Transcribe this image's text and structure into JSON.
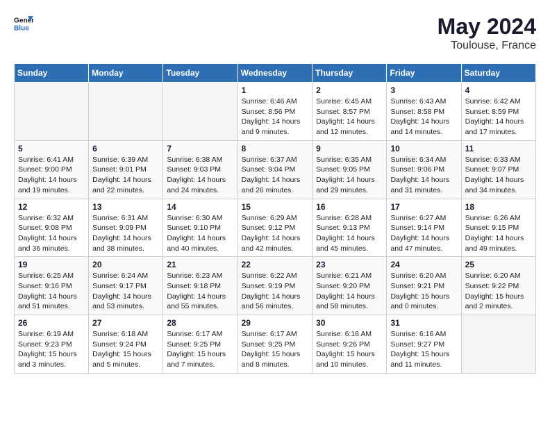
{
  "header": {
    "logo_line1": "General",
    "logo_line2": "Blue",
    "month_year": "May 2024",
    "location": "Toulouse, France"
  },
  "columns": [
    "Sunday",
    "Monday",
    "Tuesday",
    "Wednesday",
    "Thursday",
    "Friday",
    "Saturday"
  ],
  "weeks": [
    [
      {
        "day": "",
        "empty": true
      },
      {
        "day": "",
        "empty": true
      },
      {
        "day": "",
        "empty": true
      },
      {
        "day": "1",
        "sunrise": "6:46 AM",
        "sunset": "8:56 PM",
        "daylight": "14 hours and 9 minutes."
      },
      {
        "day": "2",
        "sunrise": "6:45 AM",
        "sunset": "8:57 PM",
        "daylight": "14 hours and 12 minutes."
      },
      {
        "day": "3",
        "sunrise": "6:43 AM",
        "sunset": "8:58 PM",
        "daylight": "14 hours and 14 minutes."
      },
      {
        "day": "4",
        "sunrise": "6:42 AM",
        "sunset": "8:59 PM",
        "daylight": "14 hours and 17 minutes."
      }
    ],
    [
      {
        "day": "5",
        "sunrise": "6:41 AM",
        "sunset": "9:00 PM",
        "daylight": "14 hours and 19 minutes."
      },
      {
        "day": "6",
        "sunrise": "6:39 AM",
        "sunset": "9:01 PM",
        "daylight": "14 hours and 22 minutes."
      },
      {
        "day": "7",
        "sunrise": "6:38 AM",
        "sunset": "9:03 PM",
        "daylight": "14 hours and 24 minutes."
      },
      {
        "day": "8",
        "sunrise": "6:37 AM",
        "sunset": "9:04 PM",
        "daylight": "14 hours and 26 minutes."
      },
      {
        "day": "9",
        "sunrise": "6:35 AM",
        "sunset": "9:05 PM",
        "daylight": "14 hours and 29 minutes."
      },
      {
        "day": "10",
        "sunrise": "6:34 AM",
        "sunset": "9:06 PM",
        "daylight": "14 hours and 31 minutes."
      },
      {
        "day": "11",
        "sunrise": "6:33 AM",
        "sunset": "9:07 PM",
        "daylight": "14 hours and 34 minutes."
      }
    ],
    [
      {
        "day": "12",
        "sunrise": "6:32 AM",
        "sunset": "9:08 PM",
        "daylight": "14 hours and 36 minutes."
      },
      {
        "day": "13",
        "sunrise": "6:31 AM",
        "sunset": "9:09 PM",
        "daylight": "14 hours and 38 minutes."
      },
      {
        "day": "14",
        "sunrise": "6:30 AM",
        "sunset": "9:10 PM",
        "daylight": "14 hours and 40 minutes."
      },
      {
        "day": "15",
        "sunrise": "6:29 AM",
        "sunset": "9:12 PM",
        "daylight": "14 hours and 42 minutes."
      },
      {
        "day": "16",
        "sunrise": "6:28 AM",
        "sunset": "9:13 PM",
        "daylight": "14 hours and 45 minutes."
      },
      {
        "day": "17",
        "sunrise": "6:27 AM",
        "sunset": "9:14 PM",
        "daylight": "14 hours and 47 minutes."
      },
      {
        "day": "18",
        "sunrise": "6:26 AM",
        "sunset": "9:15 PM",
        "daylight": "14 hours and 49 minutes."
      }
    ],
    [
      {
        "day": "19",
        "sunrise": "6:25 AM",
        "sunset": "9:16 PM",
        "daylight": "14 hours and 51 minutes."
      },
      {
        "day": "20",
        "sunrise": "6:24 AM",
        "sunset": "9:17 PM",
        "daylight": "14 hours and 53 minutes."
      },
      {
        "day": "21",
        "sunrise": "6:23 AM",
        "sunset": "9:18 PM",
        "daylight": "14 hours and 55 minutes."
      },
      {
        "day": "22",
        "sunrise": "6:22 AM",
        "sunset": "9:19 PM",
        "daylight": "14 hours and 56 minutes."
      },
      {
        "day": "23",
        "sunrise": "6:21 AM",
        "sunset": "9:20 PM",
        "daylight": "14 hours and 58 minutes."
      },
      {
        "day": "24",
        "sunrise": "6:20 AM",
        "sunset": "9:21 PM",
        "daylight": "15 hours and 0 minutes."
      },
      {
        "day": "25",
        "sunrise": "6:20 AM",
        "sunset": "9:22 PM",
        "daylight": "15 hours and 2 minutes."
      }
    ],
    [
      {
        "day": "26",
        "sunrise": "6:19 AM",
        "sunset": "9:23 PM",
        "daylight": "15 hours and 3 minutes."
      },
      {
        "day": "27",
        "sunrise": "6:18 AM",
        "sunset": "9:24 PM",
        "daylight": "15 hours and 5 minutes."
      },
      {
        "day": "28",
        "sunrise": "6:17 AM",
        "sunset": "9:25 PM",
        "daylight": "15 hours and 7 minutes."
      },
      {
        "day": "29",
        "sunrise": "6:17 AM",
        "sunset": "9:25 PM",
        "daylight": "15 hours and 8 minutes."
      },
      {
        "day": "30",
        "sunrise": "6:16 AM",
        "sunset": "9:26 PM",
        "daylight": "15 hours and 10 minutes."
      },
      {
        "day": "31",
        "sunrise": "6:16 AM",
        "sunset": "9:27 PM",
        "daylight": "15 hours and 11 minutes."
      },
      {
        "day": "",
        "empty": true
      }
    ]
  ],
  "labels": {
    "sunrise": "Sunrise:",
    "sunset": "Sunset:",
    "daylight": "Daylight:"
  }
}
